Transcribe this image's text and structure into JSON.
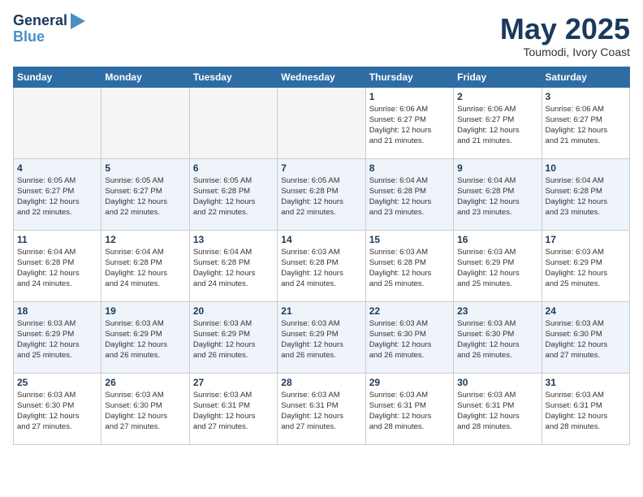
{
  "header": {
    "logo_line1": "General",
    "logo_line2": "Blue",
    "month": "May 2025",
    "location": "Toumodi, Ivory Coast"
  },
  "days_of_week": [
    "Sunday",
    "Monday",
    "Tuesday",
    "Wednesday",
    "Thursday",
    "Friday",
    "Saturday"
  ],
  "weeks": [
    [
      {
        "day": "",
        "info": ""
      },
      {
        "day": "",
        "info": ""
      },
      {
        "day": "",
        "info": ""
      },
      {
        "day": "",
        "info": ""
      },
      {
        "day": "1",
        "info": "Sunrise: 6:06 AM\nSunset: 6:27 PM\nDaylight: 12 hours\nand 21 minutes."
      },
      {
        "day": "2",
        "info": "Sunrise: 6:06 AM\nSunset: 6:27 PM\nDaylight: 12 hours\nand 21 minutes."
      },
      {
        "day": "3",
        "info": "Sunrise: 6:06 AM\nSunset: 6:27 PM\nDaylight: 12 hours\nand 21 minutes."
      }
    ],
    [
      {
        "day": "4",
        "info": "Sunrise: 6:05 AM\nSunset: 6:27 PM\nDaylight: 12 hours\nand 22 minutes."
      },
      {
        "day": "5",
        "info": "Sunrise: 6:05 AM\nSunset: 6:27 PM\nDaylight: 12 hours\nand 22 minutes."
      },
      {
        "day": "6",
        "info": "Sunrise: 6:05 AM\nSunset: 6:28 PM\nDaylight: 12 hours\nand 22 minutes."
      },
      {
        "day": "7",
        "info": "Sunrise: 6:05 AM\nSunset: 6:28 PM\nDaylight: 12 hours\nand 22 minutes."
      },
      {
        "day": "8",
        "info": "Sunrise: 6:04 AM\nSunset: 6:28 PM\nDaylight: 12 hours\nand 23 minutes."
      },
      {
        "day": "9",
        "info": "Sunrise: 6:04 AM\nSunset: 6:28 PM\nDaylight: 12 hours\nand 23 minutes."
      },
      {
        "day": "10",
        "info": "Sunrise: 6:04 AM\nSunset: 6:28 PM\nDaylight: 12 hours\nand 23 minutes."
      }
    ],
    [
      {
        "day": "11",
        "info": "Sunrise: 6:04 AM\nSunset: 6:28 PM\nDaylight: 12 hours\nand 24 minutes."
      },
      {
        "day": "12",
        "info": "Sunrise: 6:04 AM\nSunset: 6:28 PM\nDaylight: 12 hours\nand 24 minutes."
      },
      {
        "day": "13",
        "info": "Sunrise: 6:04 AM\nSunset: 6:28 PM\nDaylight: 12 hours\nand 24 minutes."
      },
      {
        "day": "14",
        "info": "Sunrise: 6:03 AM\nSunset: 6:28 PM\nDaylight: 12 hours\nand 24 minutes."
      },
      {
        "day": "15",
        "info": "Sunrise: 6:03 AM\nSunset: 6:28 PM\nDaylight: 12 hours\nand 25 minutes."
      },
      {
        "day": "16",
        "info": "Sunrise: 6:03 AM\nSunset: 6:29 PM\nDaylight: 12 hours\nand 25 minutes."
      },
      {
        "day": "17",
        "info": "Sunrise: 6:03 AM\nSunset: 6:29 PM\nDaylight: 12 hours\nand 25 minutes."
      }
    ],
    [
      {
        "day": "18",
        "info": "Sunrise: 6:03 AM\nSunset: 6:29 PM\nDaylight: 12 hours\nand 25 minutes."
      },
      {
        "day": "19",
        "info": "Sunrise: 6:03 AM\nSunset: 6:29 PM\nDaylight: 12 hours\nand 26 minutes."
      },
      {
        "day": "20",
        "info": "Sunrise: 6:03 AM\nSunset: 6:29 PM\nDaylight: 12 hours\nand 26 minutes."
      },
      {
        "day": "21",
        "info": "Sunrise: 6:03 AM\nSunset: 6:29 PM\nDaylight: 12 hours\nand 26 minutes."
      },
      {
        "day": "22",
        "info": "Sunrise: 6:03 AM\nSunset: 6:30 PM\nDaylight: 12 hours\nand 26 minutes."
      },
      {
        "day": "23",
        "info": "Sunrise: 6:03 AM\nSunset: 6:30 PM\nDaylight: 12 hours\nand 26 minutes."
      },
      {
        "day": "24",
        "info": "Sunrise: 6:03 AM\nSunset: 6:30 PM\nDaylight: 12 hours\nand 27 minutes."
      }
    ],
    [
      {
        "day": "25",
        "info": "Sunrise: 6:03 AM\nSunset: 6:30 PM\nDaylight: 12 hours\nand 27 minutes."
      },
      {
        "day": "26",
        "info": "Sunrise: 6:03 AM\nSunset: 6:30 PM\nDaylight: 12 hours\nand 27 minutes."
      },
      {
        "day": "27",
        "info": "Sunrise: 6:03 AM\nSunset: 6:31 PM\nDaylight: 12 hours\nand 27 minutes."
      },
      {
        "day": "28",
        "info": "Sunrise: 6:03 AM\nSunset: 6:31 PM\nDaylight: 12 hours\nand 27 minutes."
      },
      {
        "day": "29",
        "info": "Sunrise: 6:03 AM\nSunset: 6:31 PM\nDaylight: 12 hours\nand 28 minutes."
      },
      {
        "day": "30",
        "info": "Sunrise: 6:03 AM\nSunset: 6:31 PM\nDaylight: 12 hours\nand 28 minutes."
      },
      {
        "day": "31",
        "info": "Sunrise: 6:03 AM\nSunset: 6:31 PM\nDaylight: 12 hours\nand 28 minutes."
      }
    ]
  ]
}
